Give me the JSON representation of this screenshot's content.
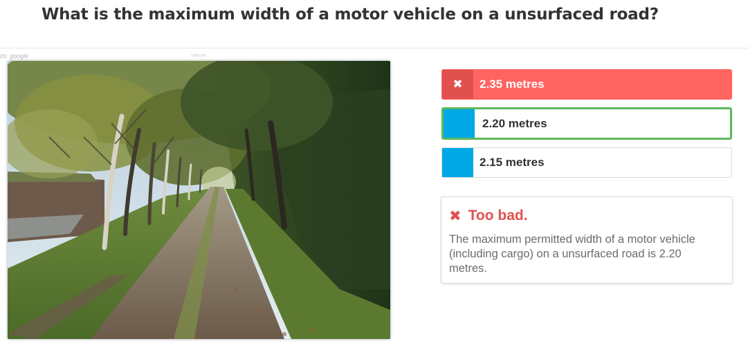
{
  "question": {
    "title": "What is the maximum width of a motor vehicle on a unsurfaced road?"
  },
  "image": {
    "credit": "its: google",
    "watermark": "1966x340"
  },
  "answers": [
    {
      "label": "2.35 metres",
      "state": "wrong",
      "icon": "x-icon"
    },
    {
      "label": "2.20 metres",
      "state": "correct",
      "icon": ""
    },
    {
      "label": "2.15 metres",
      "state": "unselected",
      "icon": ""
    }
  ],
  "feedback": {
    "title": "Too bad.",
    "icon": "x-icon",
    "text": "The maximum permitted width of a motor vehicle (including cargo) on a unsurfaced road is 2.20 metres."
  },
  "colors": {
    "wrong": "#ff6461",
    "wrong_dark": "#e0504d",
    "correct_border": "#5cb85c",
    "accent": "#00a9e6"
  }
}
